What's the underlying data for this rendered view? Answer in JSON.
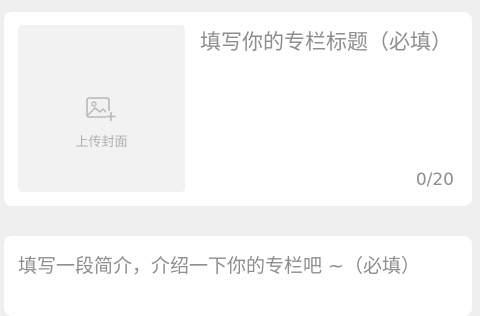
{
  "cover": {
    "icon": "image-add-icon",
    "label": "上传封面"
  },
  "title": {
    "placeholder": "填写你的专栏标题（必填）",
    "counter": "0/20"
  },
  "description": {
    "placeholder": "填写一段简介，介绍一下你的专栏吧 ~（必填）"
  }
}
